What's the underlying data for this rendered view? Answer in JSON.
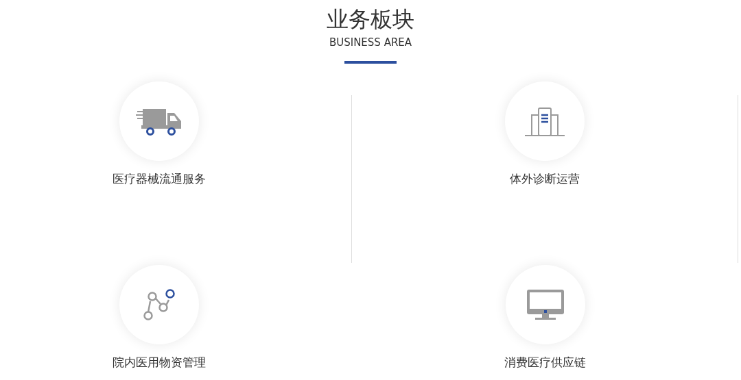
{
  "header": {
    "title": "业务板块",
    "subtitle": "BUSINESS AREA"
  },
  "items": [
    {
      "label": "医疗器械流通服务",
      "kind": "truck"
    },
    {
      "label": "体外诊断运营",
      "kind": "building"
    },
    {
      "label": "院内医用物资管理",
      "kind": "network"
    },
    {
      "label": "消费医疗供应链",
      "kind": "monitor"
    }
  ]
}
